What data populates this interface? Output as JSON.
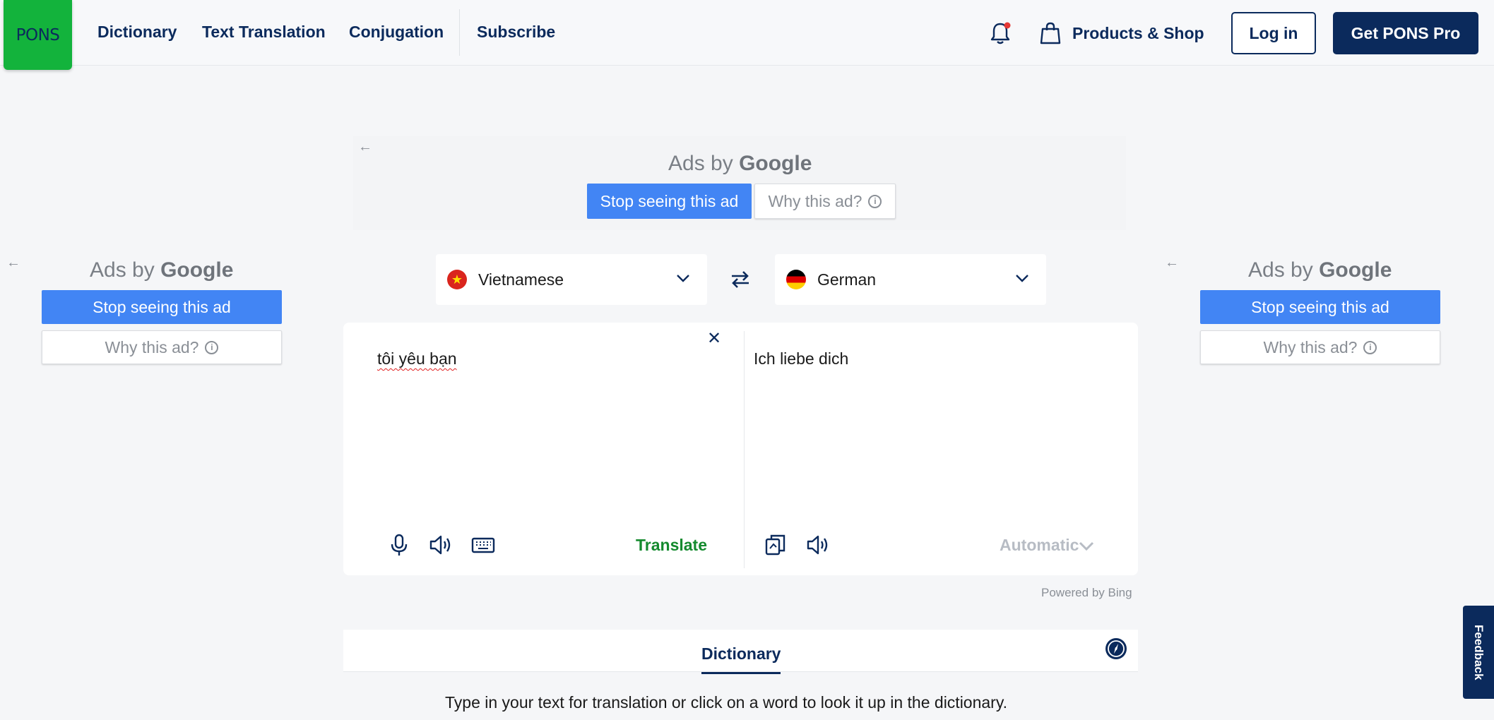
{
  "header": {
    "logo": "PONS",
    "nav": [
      "Dictionary",
      "Text Translation",
      "Conjugation",
      "Subscribe"
    ],
    "shop_label": "Products & Shop",
    "login_label": "Log in",
    "pro_label": "Get PONS Pro"
  },
  "ads": {
    "ads_by": "Ads by",
    "google": "Google",
    "stop_label": "Stop seeing this ad",
    "why_label": "Why this ad?"
  },
  "translator": {
    "source_language": "Vietnamese",
    "target_language": "German",
    "source_text": "tôi yêu bạn",
    "output_text": "Ich liebe dich",
    "translate_label": "Translate",
    "automatic_label": "Automatic",
    "powered_by": "Powered by Bing"
  },
  "dictionary": {
    "tab_label": "Dictionary",
    "hint": "Type in your text for translation or click on a word to look it up in the dictionary."
  },
  "feedback_label": "Feedback",
  "colors": {
    "brand_navy": "#0b2a5c",
    "brand_green": "#13b33c",
    "translate_green": "#148a2e",
    "google_blue": "#4285f4"
  },
  "icons": [
    "bell-icon",
    "shopping-bag-icon",
    "swap-icon",
    "microphone-icon",
    "speaker-icon",
    "keyboard-icon",
    "copy-icon",
    "compass-icon",
    "chevron-down-icon",
    "close-icon",
    "info-icon",
    "back-arrow-icon"
  ]
}
